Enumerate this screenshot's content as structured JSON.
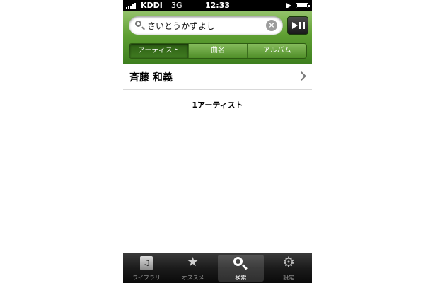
{
  "status_bar": {
    "carrier": "KDDI",
    "network": "3G",
    "time": "12:33"
  },
  "search": {
    "query": "さいとうかずよし"
  },
  "segments": [
    {
      "label": "アーティスト",
      "active": true
    },
    {
      "label": "曲名",
      "active": false
    },
    {
      "label": "アルバム",
      "active": false
    }
  ],
  "results": {
    "items": [
      {
        "label": "斉藤 和義"
      }
    ],
    "count_label": "1アーティスト"
  },
  "tab_bar": {
    "items": [
      {
        "label": "ライブラリ",
        "icon": "library-icon"
      },
      {
        "label": "オススメ",
        "icon": "stars-icon"
      },
      {
        "label": "検索",
        "icon": "search-icon",
        "active": true
      },
      {
        "label": "設定",
        "icon": "gear-icon"
      }
    ]
  },
  "colors": {
    "header_green": "#5f9f32",
    "tab_bar": "#1b1b1b"
  }
}
